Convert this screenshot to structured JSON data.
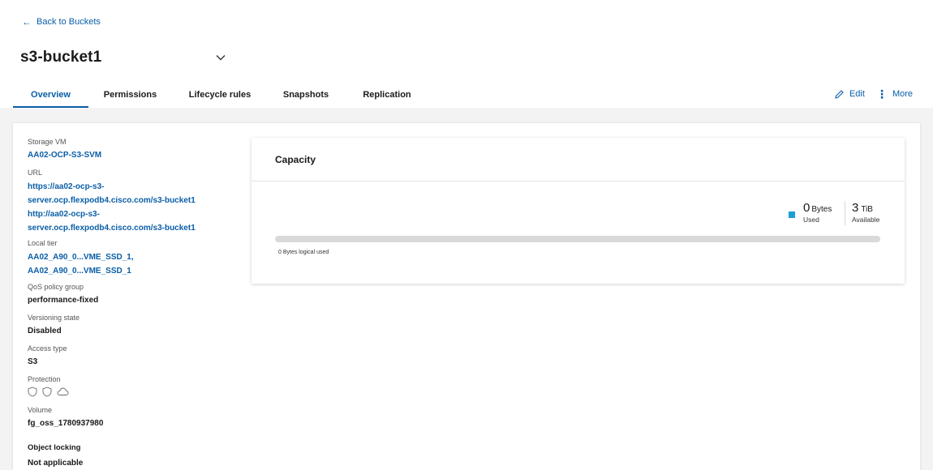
{
  "nav": {
    "back_label": "Back to Buckets"
  },
  "header": {
    "title": "s3-bucket1"
  },
  "tabs": [
    {
      "label": "Overview"
    },
    {
      "label": "Permissions"
    },
    {
      "label": "Lifecycle rules"
    },
    {
      "label": "Snapshots"
    },
    {
      "label": "Replication"
    }
  ],
  "actions": {
    "edit_label": "Edit",
    "more_label": "More"
  },
  "details": {
    "storage_vm": {
      "label": "Storage VM",
      "value": "AA02-OCP-S3-SVM"
    },
    "url": {
      "label": "URL",
      "values": [
        "https://aa02-ocp-s3-",
        "server.ocp.flexpodb4.cisco.com/s3-bucket1",
        "http://aa02-ocp-s3-",
        "server.ocp.flexpodb4.cisco.com/s3-bucket1"
      ]
    },
    "local_tier": {
      "label": "Local tier",
      "values": [
        "AA02_A90_0...VME_SSD_1,",
        "AA02_A90_0...VME_SSD_1"
      ]
    },
    "qos": {
      "label": "QoS policy group",
      "value": "performance-fixed"
    },
    "versioning": {
      "label": "Versioning state",
      "value": "Disabled"
    },
    "access_type": {
      "label": "Access type",
      "value": "S3"
    },
    "protection": {
      "label": "Protection",
      "icons": [
        "shield-icon",
        "shield-icon",
        "cloud-icon"
      ]
    },
    "volume": {
      "label": "Volume",
      "value": "fg_oss_1780937980"
    },
    "object_locking": {
      "label": "Object locking",
      "value": "Not applicable"
    }
  },
  "capacity": {
    "title": "Capacity",
    "used_value": "0",
    "used_unit": "Bytes",
    "used_label": "Used",
    "available_value": "3",
    "available_unit": "TiB",
    "available_label": "Available",
    "used_fraction": 0,
    "logical_used_text": "0 Bytes logical used"
  },
  "colors": {
    "accent": "#0a5ea8",
    "used": "#1aa0d8",
    "track": "#d9d9d9"
  }
}
